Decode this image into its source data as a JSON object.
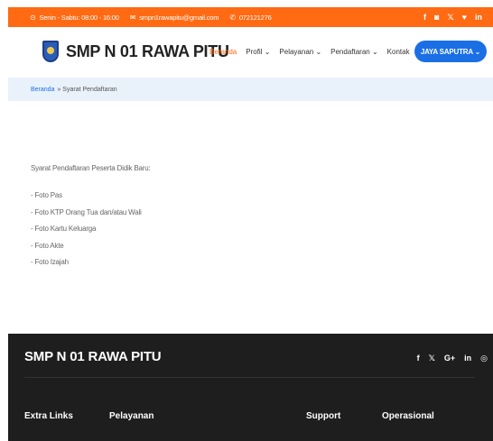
{
  "topbar": {
    "hours": "Senin - Sabtu: 08:00 - 16:00",
    "email": "smpn1rawapitu@gmail.com",
    "phone": "072121276",
    "social": [
      "f",
      "◙",
      "𝕏",
      "♥",
      "in"
    ]
  },
  "header": {
    "brand": "SMP N 01 RAWA PITU",
    "nav": [
      {
        "label": "Beranda",
        "active": true
      },
      {
        "label": "Profil ⌄"
      },
      {
        "label": "Pelayanan ⌄"
      },
      {
        "label": "Pendaftaran ⌄"
      },
      {
        "label": "Kontak"
      }
    ],
    "user_button": "JAYA SAPUTRA ⌄"
  },
  "breadcrumb": {
    "home": "Beranda",
    "current": "» Syarat Pendaftaran"
  },
  "content": {
    "intro": "Syarat Pendaftaran Peserta Didik Baru:",
    "requirements": [
      "- Foto Pas",
      "- Foto KTP Orang Tua dan/atau Wali",
      "- Foto Kartu Keluarga",
      "- Foto Akte",
      "- Foto Izajah"
    ]
  },
  "footer": {
    "brand": "SMP N 01 RAWA PITU",
    "social": [
      "f",
      "𝕏",
      "G+",
      "in",
      "◎"
    ],
    "columns": [
      "Extra Links",
      "Pelayanan",
      "Support",
      "Operasional"
    ]
  },
  "colors": {
    "accent_orange": "#ff6a13",
    "primary_blue": "#1b6fe4",
    "footer_bg": "#1e1e1e",
    "breadcrumb_bg": "#e9f1fb"
  }
}
